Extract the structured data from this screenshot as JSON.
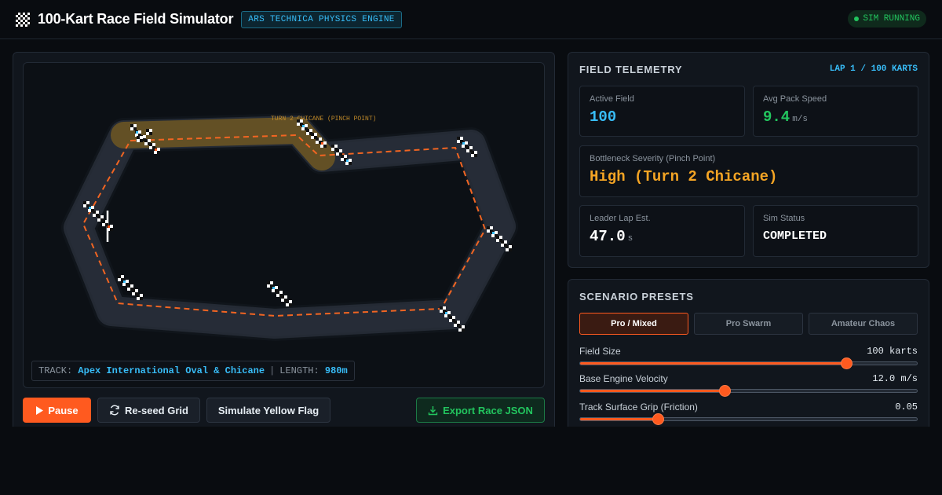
{
  "header": {
    "title": "100-Kart Race Field Simulator",
    "engine_badge": "ARS TECHNICA PHYSICS ENGINE",
    "status": "SIM RUNNING",
    "logo_icon": "checkered-flag-icon"
  },
  "track": {
    "pinch_label": "TURN 2 CHICANE (PINCH POINT)",
    "track_label": "TRACK:",
    "track_name": "Apex International Oval & Chicane",
    "length_label": "LENGTH:",
    "length_value": "980m"
  },
  "controls": {
    "pause": "Pause",
    "reseed": "Re-seed Grid",
    "yellow_flag": "Simulate Yellow Flag",
    "export": "Export Race JSON"
  },
  "telemetry": {
    "title": "FIELD TELEMETRY",
    "lap": "LAP 1 / 100 KARTS",
    "active_field_label": "Active Field",
    "active_field_value": "100",
    "pack_speed_label": "Avg Pack Speed",
    "pack_speed_value": "9.4",
    "pack_speed_unit": "m/s",
    "bottleneck_label": "Bottleneck Severity (Pinch Point)",
    "bottleneck_value": "High (Turn 2 Chicane)",
    "leader_label": "Leader Lap Est.",
    "leader_value": "47.0",
    "leader_unit": "s",
    "status_label": "Sim Status",
    "status_value": "COMPLETED"
  },
  "presets": {
    "title": "SCENARIO PRESETS",
    "options": [
      "Pro / Mixed",
      "Pro Swarm",
      "Amateur Chaos"
    ],
    "active": "Pro / Mixed"
  },
  "sliders": [
    {
      "label": "Field Size",
      "value": "100 karts",
      "level": 0.79
    },
    {
      "label": "Base Engine Velocity",
      "value": "12.0 m/s",
      "level": 0.43
    },
    {
      "label": "Track Surface Grip (Friction)",
      "value": "0.05",
      "level": 0.23
    }
  ],
  "colors": {
    "accent": "#ff5a1f",
    "info": "#38bdf8",
    "success": "#22c55e",
    "warning": "#f5a524"
  }
}
